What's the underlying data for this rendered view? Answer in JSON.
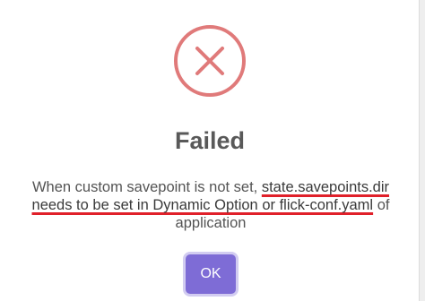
{
  "dialog": {
    "icon": "error-x-icon",
    "icon_color": "#e07a7a",
    "title": "Failed",
    "message_prefix": "When custom savepoint is not set, ",
    "message_highlight_1": "state.savepoints.dir",
    "message_highlight_2": "needs to be set in Dynamic Option or flick-conf.yaml",
    "message_suffix": " of application",
    "highlight_color": "#e0202a",
    "ok_label": "OK",
    "ok_color": "#7e6cd6"
  }
}
